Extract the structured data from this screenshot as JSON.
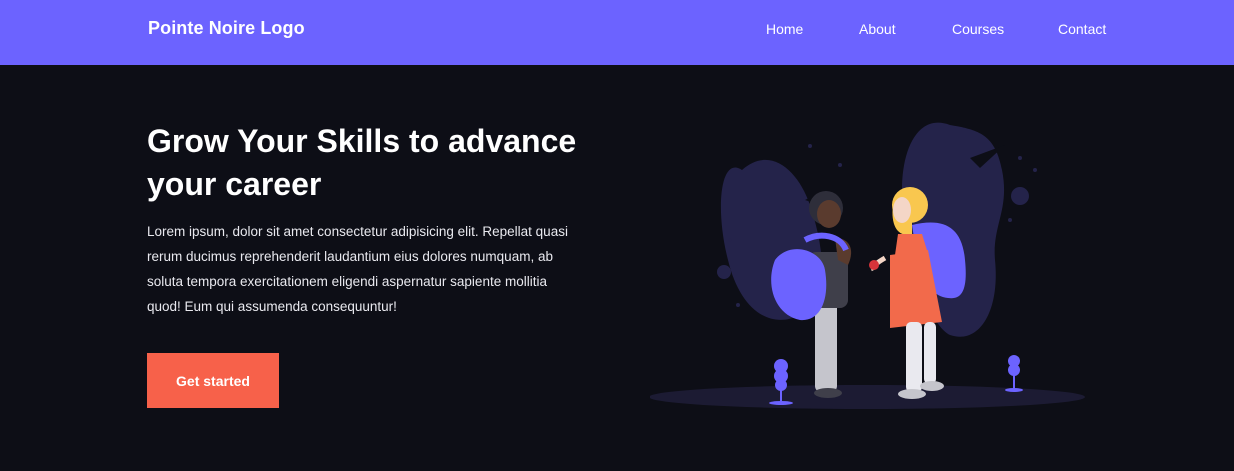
{
  "header": {
    "logo": "Pointe Noire Logo",
    "nav": [
      {
        "label": "Home"
      },
      {
        "label": "About"
      },
      {
        "label": "Courses"
      },
      {
        "label": "Contact"
      }
    ]
  },
  "hero": {
    "title": "Grow Your Skills to advance your career",
    "text": "Lorem ipsum, dolor sit amet consectetur adipisicing elit. Repellat quasi rerum ducimus reprehenderit laudantium eius dolores numquam, ab soluta tempora exercitationem eligendi aspernatur sapiente mollitia quod! Eum qui assumenda consequuntur!",
    "cta_label": "Get started",
    "illustration": "students-with-backpacks-illustration"
  },
  "colors": {
    "navbar": "#6c63ff",
    "background": "#0d0e16",
    "button": "#f7614a",
    "accent_dark": "#2a2950"
  }
}
